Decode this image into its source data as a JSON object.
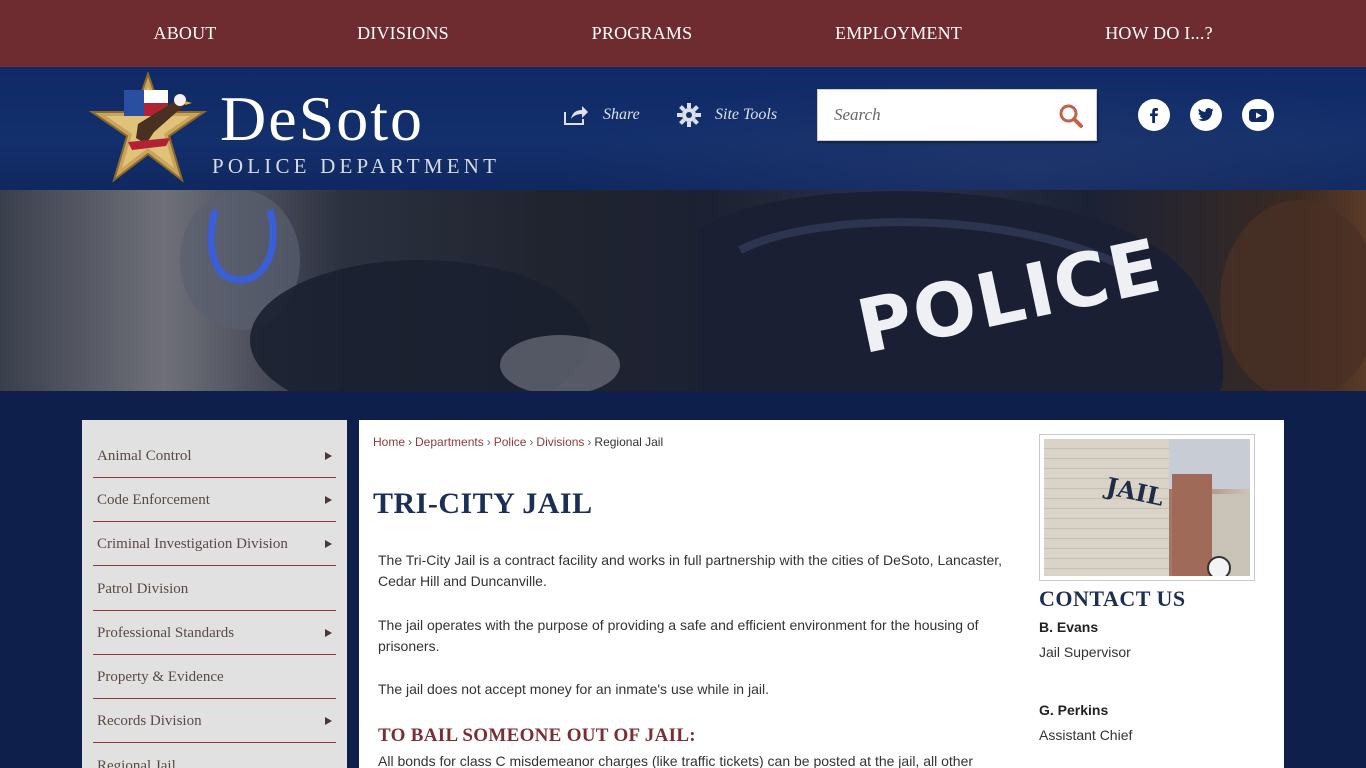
{
  "topnav": {
    "items": [
      {
        "label": "ABOUT"
      },
      {
        "label": "DIVISIONS"
      },
      {
        "label": "PROGRAMS"
      },
      {
        "label": "EMPLOYMENT"
      },
      {
        "label": "HOW DO I...?"
      }
    ]
  },
  "header": {
    "logo_name": "DeSoto",
    "logo_sub": "POLICE DEPARTMENT",
    "share_label": "Share",
    "site_tools_label": "Site Tools",
    "search_placeholder": "Search"
  },
  "social": {
    "icons": [
      "facebook-icon",
      "twitter-icon",
      "youtube-icon"
    ]
  },
  "hero": {
    "cap_text": "POLICE"
  },
  "sidebar": {
    "items": [
      {
        "label": "Animal Control",
        "has_submenu": true
      },
      {
        "label": "Code Enforcement",
        "has_submenu": true
      },
      {
        "label": "Criminal Investigation Division",
        "has_submenu": true
      },
      {
        "label": "Patrol Division",
        "has_submenu": false
      },
      {
        "label": "Professional Standards",
        "has_submenu": true
      },
      {
        "label": "Property & Evidence",
        "has_submenu": false
      },
      {
        "label": "Records Division",
        "has_submenu": true
      },
      {
        "label": "Regional Jail",
        "has_submenu": false
      }
    ]
  },
  "breadcrumb": {
    "links": [
      "Home",
      "Departments",
      "Police",
      "Divisions"
    ],
    "current": "Regional Jail"
  },
  "main": {
    "title": "TRI-CITY JAIL",
    "para1": "The Tri-City Jail is a contract facility and works in full partnership with the cities of DeSoto, Lancaster, Cedar Hill and Duncanville.",
    "para2": "The jail operates with the purpose of providing a safe and efficient environment for the housing of prisoners.",
    "para3": "The jail does not accept money for an inmate's use while in jail.",
    "subhead": "TO BAIL SOMEONE OUT OF JAIL:",
    "para4": "All bonds for class C misdemeanor charges (like traffic tickets) can be posted at the jail, all other"
  },
  "aside": {
    "image_text": "JAIL",
    "contact_title": "CONTACT US",
    "contacts": [
      {
        "name": "B. Evans",
        "role": "Jail Supervisor"
      },
      {
        "name": "G. Perkins",
        "role": "Assistant Chief"
      }
    ]
  },
  "colors": {
    "topnav_bg": "#6e2c30",
    "header_bg": "#132f6c",
    "accent": "#8e3a3e",
    "title": "#1c2e54"
  }
}
